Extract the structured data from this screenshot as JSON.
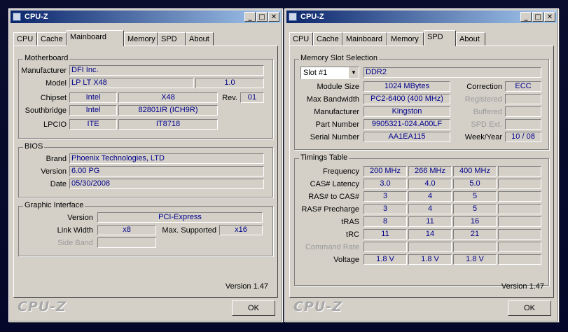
{
  "window_title": "CPU-Z",
  "tabs": [
    "CPU",
    "Cache",
    "Mainboard",
    "Memory",
    "SPD",
    "About"
  ],
  "footer": {
    "version": "Version 1.47",
    "logo": "CPU-Z",
    "ok": "OK"
  },
  "mainboard": {
    "motherboard_title": "Motherboard",
    "manufacturer_label": "Manufacturer",
    "manufacturer": "DFI Inc.",
    "model_label": "Model",
    "model": "LP LT X48",
    "model_rev": "1.0",
    "chipset_label": "Chipset",
    "chipset_vendor": "Intel",
    "chipset_model": "X48",
    "rev_label": "Rev.",
    "chipset_rev": "01",
    "southbridge_label": "Southbridge",
    "southbridge_vendor": "Intel",
    "southbridge_model": "82801IR (ICH9R)",
    "lpcio_label": "LPCIO",
    "lpcio_vendor": "ITE",
    "lpcio_model": "IT8718",
    "bios_title": "BIOS",
    "brand_label": "Brand",
    "brand": "Phoenix Technologies, LTD",
    "version_label": "Version",
    "version": "6.00 PG",
    "date_label": "Date",
    "date": "05/30/2008",
    "graphic_title": "Graphic Interface",
    "gi_version_label": "Version",
    "gi_version": "PCI-Express",
    "link_width_label": "Link Width",
    "link_width": "x8",
    "max_supported_label": "Max. Supported",
    "max_supported": "x16",
    "side_band_label": "Side Band"
  },
  "spd": {
    "slot_title": "Memory Slot Selection",
    "slot": "Slot #1",
    "type": "DDR2",
    "module_size_label": "Module Size",
    "module_size": "1024 MBytes",
    "max_bw_label": "Max Bandwidth",
    "max_bw": "PC2-6400 (400 MHz)",
    "manufacturer_label": "Manufacturer",
    "manufacturer": "Kingston",
    "part_label": "Part Number",
    "part": "9905321-024.A00LF",
    "serial_label": "Serial Number",
    "serial": "AA1EA115",
    "correction_label": "Correction",
    "correction": "ECC",
    "registered_label": "Registered",
    "buffered_label": "Buffered",
    "spd_ext_label": "SPD Ext.",
    "weekyear_label": "Week/Year",
    "weekyear": "10 / 08",
    "timings_title": "Timings Table",
    "rows": [
      {
        "label": "Frequency",
        "vals": [
          "200 MHz",
          "266 MHz",
          "400 MHz",
          ""
        ],
        "dis": false
      },
      {
        "label": "CAS# Latency",
        "vals": [
          "3.0",
          "4.0",
          "5.0",
          ""
        ],
        "dis": false
      },
      {
        "label": "RAS# to CAS#",
        "vals": [
          "3",
          "4",
          "5",
          ""
        ],
        "dis": false
      },
      {
        "label": "RAS# Precharge",
        "vals": [
          "3",
          "4",
          "5",
          ""
        ],
        "dis": false
      },
      {
        "label": "tRAS",
        "vals": [
          "8",
          "11",
          "16",
          ""
        ],
        "dis": false
      },
      {
        "label": "tRC",
        "vals": [
          "11",
          "14",
          "21",
          ""
        ],
        "dis": false
      },
      {
        "label": "Command Rate",
        "vals": [
          "",
          "",
          "",
          ""
        ],
        "dis": true
      },
      {
        "label": "Voltage",
        "vals": [
          "1.8 V",
          "1.8 V",
          "1.8 V",
          ""
        ],
        "dis": false
      }
    ]
  }
}
